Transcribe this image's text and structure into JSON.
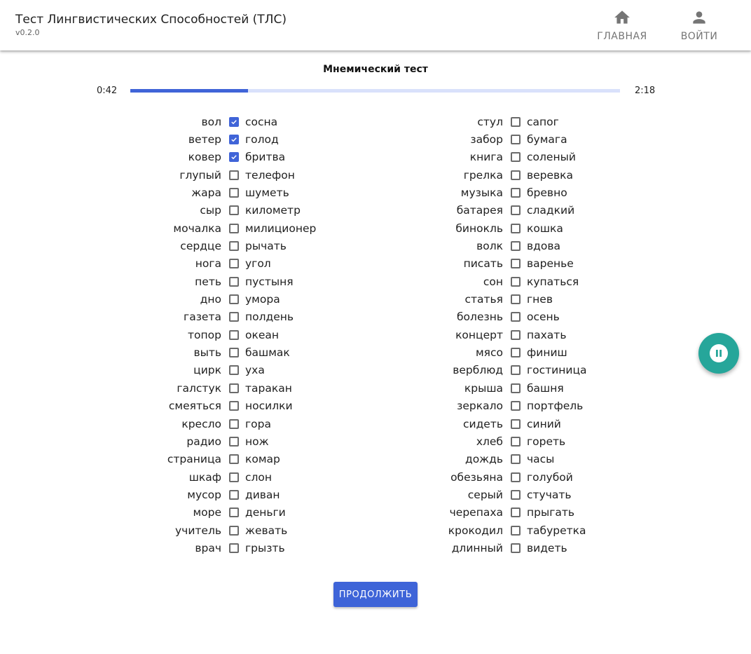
{
  "app": {
    "title": "Тест Лингвистических Способностей (ТЛС)",
    "version": "v0.2.0"
  },
  "nav": {
    "home": {
      "label": "ГЛАВНАЯ",
      "icon": "home-icon"
    },
    "login": {
      "label": "ВОЙТИ",
      "icon": "person-icon"
    }
  },
  "test": {
    "title": "Мнемический тест",
    "elapsed": "0:42",
    "total": "2:18",
    "progress_fraction": 0.24,
    "continue_label": "ПРОДОЛЖИТЬ"
  },
  "colors": {
    "accent": "#4064d8",
    "fab": "#26a69a"
  },
  "pairs_left": [
    {
      "stimulus": "вол",
      "response": "сосна",
      "checked": true
    },
    {
      "stimulus": "ветер",
      "response": "голод",
      "checked": true
    },
    {
      "stimulus": "ковер",
      "response": "бритва",
      "checked": true
    },
    {
      "stimulus": "глупый",
      "response": "телефон",
      "checked": false
    },
    {
      "stimulus": "жара",
      "response": "шуметь",
      "checked": false
    },
    {
      "stimulus": "сыр",
      "response": "километр",
      "checked": false
    },
    {
      "stimulus": "мочалка",
      "response": "милиционер",
      "checked": false
    },
    {
      "stimulus": "сердце",
      "response": "рычать",
      "checked": false
    },
    {
      "stimulus": "нога",
      "response": "угол",
      "checked": false
    },
    {
      "stimulus": "петь",
      "response": "пустыня",
      "checked": false
    },
    {
      "stimulus": "дно",
      "response": "умора",
      "checked": false
    },
    {
      "stimulus": "газета",
      "response": "полдень",
      "checked": false
    },
    {
      "stimulus": "топор",
      "response": "океан",
      "checked": false
    },
    {
      "stimulus": "выть",
      "response": "башмак",
      "checked": false
    },
    {
      "stimulus": "цирк",
      "response": "уха",
      "checked": false
    },
    {
      "stimulus": "галстук",
      "response": "таракан",
      "checked": false
    },
    {
      "stimulus": "смеяться",
      "response": "носилки",
      "checked": false
    },
    {
      "stimulus": "кресло",
      "response": "гора",
      "checked": false
    },
    {
      "stimulus": "радио",
      "response": "нож",
      "checked": false
    },
    {
      "stimulus": "страница",
      "response": "комар",
      "checked": false
    },
    {
      "stimulus": "шкаф",
      "response": "слон",
      "checked": false
    },
    {
      "stimulus": "мусор",
      "response": "диван",
      "checked": false
    },
    {
      "stimulus": "море",
      "response": "деньги",
      "checked": false
    },
    {
      "stimulus": "учитель",
      "response": "жевать",
      "checked": false
    },
    {
      "stimulus": "врач",
      "response": "грызть",
      "checked": false
    }
  ],
  "pairs_right": [
    {
      "stimulus": "стул",
      "response": "сапог",
      "checked": false
    },
    {
      "stimulus": "забор",
      "response": "бумага",
      "checked": false
    },
    {
      "stimulus": "книга",
      "response": "соленый",
      "checked": false
    },
    {
      "stimulus": "грелка",
      "response": "веревка",
      "checked": false
    },
    {
      "stimulus": "музыка",
      "response": "бревно",
      "checked": false
    },
    {
      "stimulus": "батарея",
      "response": "сладкий",
      "checked": false
    },
    {
      "stimulus": "бинокль",
      "response": "кошка",
      "checked": false
    },
    {
      "stimulus": "волк",
      "response": "вдова",
      "checked": false
    },
    {
      "stimulus": "писать",
      "response": "варенье",
      "checked": false
    },
    {
      "stimulus": "сон",
      "response": "купаться",
      "checked": false
    },
    {
      "stimulus": "статья",
      "response": "гнев",
      "checked": false
    },
    {
      "stimulus": "болезнь",
      "response": "осень",
      "checked": false
    },
    {
      "stimulus": "концерт",
      "response": "пахать",
      "checked": false
    },
    {
      "stimulus": "мясо",
      "response": "финиш",
      "checked": false
    },
    {
      "stimulus": "верблюд",
      "response": "гостиница",
      "checked": false
    },
    {
      "stimulus": "крыша",
      "response": "башня",
      "checked": false
    },
    {
      "stimulus": "зеркало",
      "response": "портфель",
      "checked": false
    },
    {
      "stimulus": "сидеть",
      "response": "синий",
      "checked": false
    },
    {
      "stimulus": "хлеб",
      "response": "гореть",
      "checked": false
    },
    {
      "stimulus": "дождь",
      "response": "часы",
      "checked": false
    },
    {
      "stimulus": "обезьяна",
      "response": "голубой",
      "checked": false
    },
    {
      "stimulus": "серый",
      "response": "стучать",
      "checked": false
    },
    {
      "stimulus": "черепаха",
      "response": "прыгать",
      "checked": false
    },
    {
      "stimulus": "крокодил",
      "response": "табуретка",
      "checked": false
    },
    {
      "stimulus": "длинный",
      "response": "видеть",
      "checked": false
    }
  ],
  "fab": {
    "icon": "pause-icon"
  }
}
